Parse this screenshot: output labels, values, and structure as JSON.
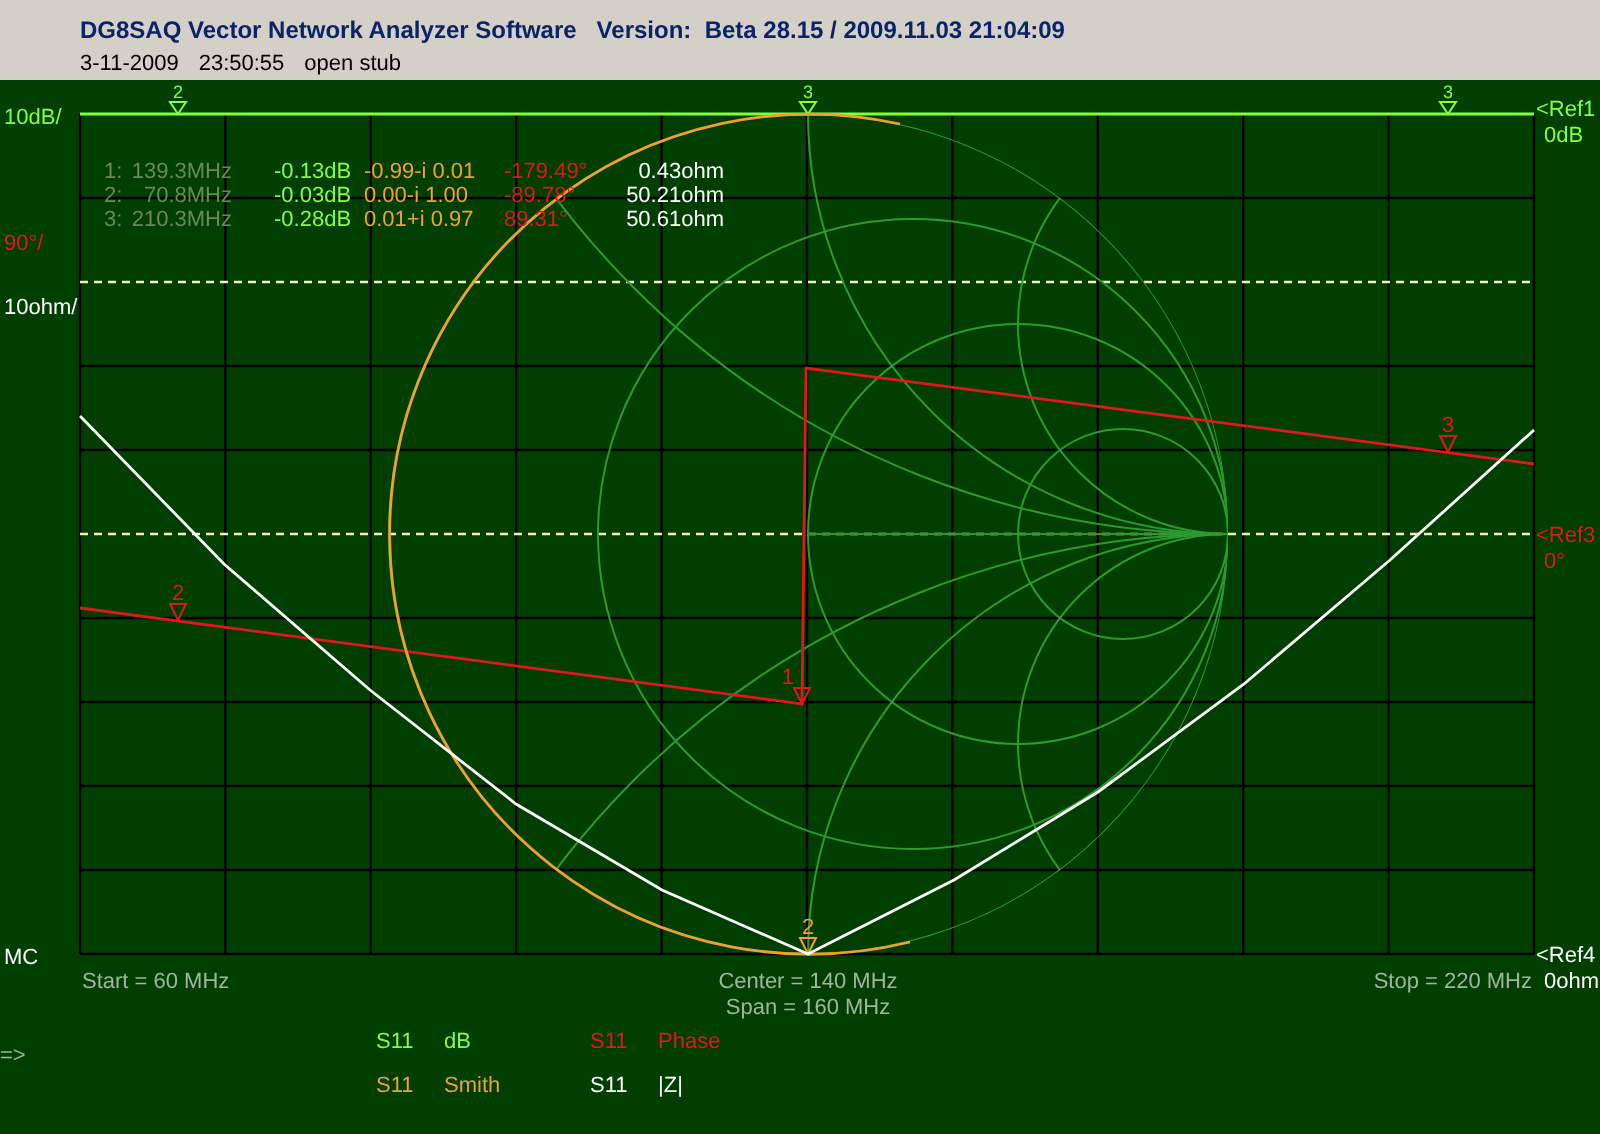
{
  "window": {
    "title": "DG8SAQ Vector Network Analyzer Software   Version:  Beta 28.15 / 2009.11.03 21:04:09"
  },
  "measurement": {
    "date": "3-11-2009",
    "time": "23:50:55",
    "note": "open stub"
  },
  "marker_table": [
    {
      "label": "1:",
      "frequency": "139.3MHz",
      "magnitude": "-0.13dB",
      "reflection": "-0.99-i 0.01",
      "phase": "-179.49°",
      "impedance": "0.43ohm"
    },
    {
      "label": "2:",
      "frequency": "70.8MHz",
      "magnitude": "-0.03dB",
      "reflection": "0.00-i 1.00",
      "phase": "-89.78°",
      "impedance": "50.21ohm"
    },
    {
      "label": "3:",
      "frequency": "210.3MHz",
      "magnitude": "-0.28dB",
      "reflection": "0.01+i 0.97",
      "phase": "89.31°",
      "impedance": "50.61ohm"
    }
  ],
  "traces": [
    {
      "kind": "db",
      "parameter": "S11",
      "format": "dB",
      "color": "#80ff40",
      "scale": "10dB/",
      "ref": "<Ref1",
      "ref_value": "0dB",
      "markers": [
        {
          "label": "2"
        },
        {
          "label": "3"
        },
        {
          "label": "3"
        }
      ]
    },
    {
      "kind": "phase",
      "parameter": "S11",
      "format": "Phase",
      "color": "#e01818",
      "scale": "90°/",
      "ref": "<Ref3",
      "ref_value": "0°",
      "markers": [
        {
          "label": "2"
        },
        {
          "label": "1"
        },
        {
          "label": "3"
        }
      ]
    },
    {
      "kind": "smith",
      "parameter": "S11",
      "format": "Smith",
      "color": "#f0a030",
      "markers": [
        {
          "label": "2"
        }
      ]
    },
    {
      "kind": "impedance",
      "parameter": "S11",
      "format": "|Z|",
      "color": "#ffffff",
      "scale": "10ohm/",
      "ref": "<Ref4",
      "ref_value": "0ohm"
    }
  ],
  "mode_label": "MC",
  "prompt": "=>",
  "axis": {
    "start": "Start = 60 MHz",
    "center": "Center = 140 MHz",
    "span": "Span = 160 MHz",
    "stop": "Stop = 220 MHz"
  }
}
